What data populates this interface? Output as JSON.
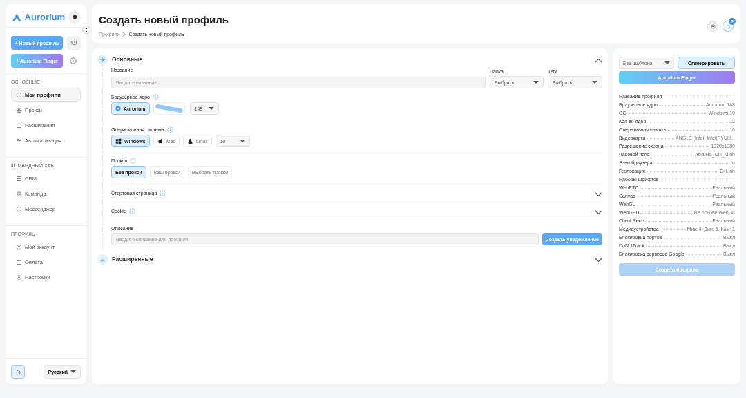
{
  "sidebar": {
    "brand": "Aurorium",
    "new_profile_button": "+ Новый профиль",
    "finger_button": "+ Aurorium Finger",
    "sections": [
      {
        "title": "ОСНОВНЫЕ",
        "items": [
          {
            "label": "Мои профили",
            "selected": true
          },
          {
            "label": "Прокси",
            "selected": false
          },
          {
            "label": "Расширения",
            "selected": false
          },
          {
            "label": "Автоматизация",
            "selected": false
          }
        ]
      },
      {
        "title": "КОМАНДНЫЙ ХАБ",
        "items": [
          {
            "label": "CRM",
            "selected": false
          },
          {
            "label": "Команда",
            "selected": false
          },
          {
            "label": "Мессенджер",
            "selected": false
          }
        ]
      },
      {
        "title": "ПРОФИЛЬ",
        "items": [
          {
            "label": "Мой аккаунт",
            "selected": false
          },
          {
            "label": "Оплата",
            "selected": false
          },
          {
            "label": "Настройки",
            "selected": false
          }
        ]
      }
    ],
    "language": "Русский"
  },
  "header": {
    "title": "Создать новый профиль",
    "breadcrumbs": [
      "Профили",
      "Создать новый профиль"
    ],
    "notification_count": "2"
  },
  "basic": {
    "title": "Основные",
    "expanded": true,
    "name": {
      "label": "Название",
      "placeholder": "Вводите название"
    },
    "folder": {
      "label": "Папка",
      "value": "Выбрать"
    },
    "tags": {
      "label": "Теги",
      "value": "Выбрать"
    },
    "engine": {
      "label": "Браузерное ядро",
      "options": [
        {
          "label": "Aurorium",
          "selected": true
        }
      ],
      "version": "148"
    },
    "os": {
      "label": "Операционная система",
      "options": [
        {
          "label": "Windows",
          "selected": true
        },
        {
          "label": "Mac",
          "selected": false
        },
        {
          "label": "Linux",
          "selected": false
        }
      ],
      "version": "10"
    },
    "proxy": {
      "label": "Прокси",
      "options": [
        {
          "label": "Без прокси",
          "selected": true
        },
        {
          "label": "Ваш прокси",
          "selected": false
        },
        {
          "label": "Выбрать прокси",
          "selected": false
        }
      ]
    },
    "collapsibles": [
      {
        "label": "Стартовая страница",
        "expanded": false
      },
      {
        "label": "Cookie",
        "expanded": false
      }
    ],
    "description": {
      "label": "Описание",
      "placeholder": "Вводите описание для профиля",
      "button": "Создать уведомление"
    }
  },
  "advanced": {
    "title": "Расширенные",
    "expanded": false
  },
  "summary": {
    "template": "Без шаблона",
    "generate_button": "Сгенерировать",
    "finger_button": "Aurorium Finger",
    "rows": [
      {
        "label": "Название профиля",
        "value": "-"
      },
      {
        "label": "Браузерное ядро",
        "value": "Aurorium 148"
      },
      {
        "label": "ОС",
        "value": "Windows 10"
      },
      {
        "label": "Кол-во ядер",
        "value": "12"
      },
      {
        "label": "Оперативная память",
        "value": "16"
      },
      {
        "label": "Видеокарта",
        "value": "ANGLE (Intel, Intel(R) UH..."
      },
      {
        "label": "Разрешение экрана",
        "value": "1920x1080"
      },
      {
        "label": "Часовой пояс",
        "value": "Asia/Ho_Chi_Minh"
      },
      {
        "label": "Язык браузера",
        "value": "ru"
      },
      {
        "label": "Геолокация",
        "value": "Di Linh"
      },
      {
        "label": "Наборы шрифтов",
        "value": "-"
      },
      {
        "label": "WebRTC",
        "value": "Реальный"
      },
      {
        "label": "Canvas",
        "value": "Реальный"
      },
      {
        "label": "WebGL",
        "value": "Реальный"
      },
      {
        "label": "WebGPU",
        "value": "На основе WebGL"
      },
      {
        "label": "Client Rects",
        "value": "Реальный"
      },
      {
        "label": "Медиаустройства",
        "value": "Мик: 4, Дин: 5, Кам: 1"
      },
      {
        "label": "Блокировка портов",
        "value": "Выкл"
      },
      {
        "label": "DoNotTrack",
        "value": "Выкл"
      },
      {
        "label": "Блокировка сервисов Google",
        "value": "Выкл"
      }
    ],
    "create_button": "Создать профиль",
    "create_disabled": true
  }
}
